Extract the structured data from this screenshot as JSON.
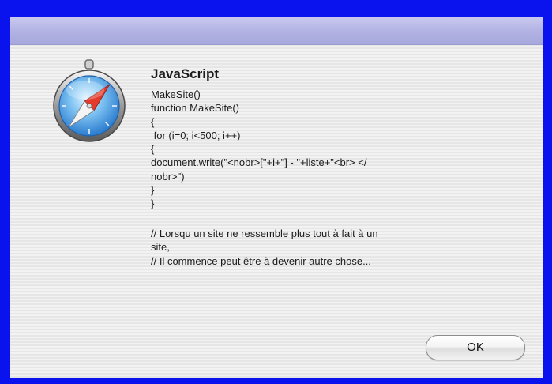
{
  "dialog": {
    "icon": "compass-icon",
    "heading": "JavaScript",
    "code_lines": [
      "MakeSite()",
      "function MakeSite()",
      "{",
      " for (i=0; i<500; i++)",
      "{",
      "document.write(\"<nobr>[\"+i+\"] - \"+liste+\"<br> </",
      "nobr>\")",
      "}",
      "}"
    ],
    "comment_lines": [
      "// Lorsqu un site ne ressemble plus tout à fait à un",
      "site,",
      "// Il commence peut être à devenir autre chose..."
    ],
    "ok_label": "OK"
  },
  "colors": {
    "frame": "#0a12ee",
    "titlebar": "#b2b3e3",
    "background": "#ececec"
  }
}
